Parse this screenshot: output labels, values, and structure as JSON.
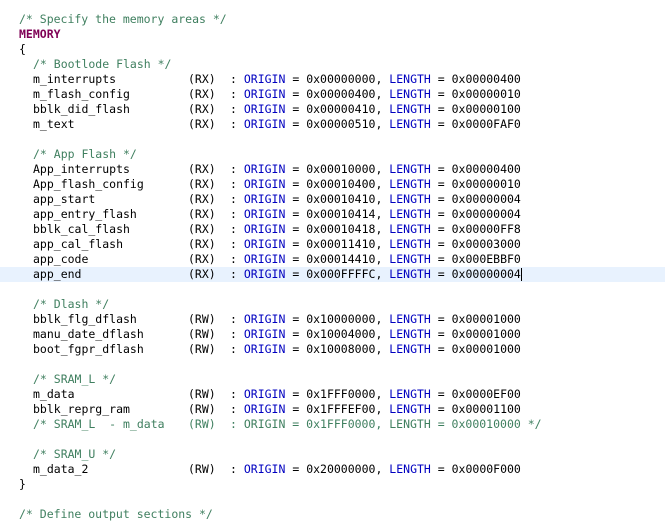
{
  "editor": {
    "header_comment": "/* Specify the memory areas */",
    "keyword_memory": "MEMORY",
    "brace_open": "{",
    "brace_close": "}",
    "footer_comment_partial": "/* Define output sections */",
    "labels": {
      "colon": ":",
      "origin": "ORIGIN",
      "equals": "=",
      "length": "LENGTH",
      "comma": ","
    },
    "groups": [
      {
        "comment": "/* Bootlode Flash */",
        "entries": [
          {
            "name": "m_interrupts",
            "attr": "(RX)",
            "origin": "0x00000000",
            "length": "0x00000400"
          },
          {
            "name": "m_flash_config",
            "attr": "(RX)",
            "origin": "0x00000400",
            "length": "0x00000010"
          },
          {
            "name": "bblk_did_flash",
            "attr": "(RX)",
            "origin": "0x00000410",
            "length": "0x00000100"
          },
          {
            "name": "m_text",
            "attr": "(RX)",
            "origin": "0x00000510",
            "length": "0x0000FAF0"
          }
        ]
      },
      {
        "comment": "/* App Flash */",
        "entries": [
          {
            "name": "App_interrupts",
            "attr": "(RX)",
            "origin": "0x00010000",
            "length": "0x00000400"
          },
          {
            "name": "App_flash_config",
            "attr": "(RX)",
            "origin": "0x00010400",
            "length": "0x00000010"
          },
          {
            "name": "app_start",
            "attr": "(RX)",
            "origin": "0x00010410",
            "length": "0x00000004"
          },
          {
            "name": "app_entry_flash",
            "attr": "(RX)",
            "origin": "0x00010414",
            "length": "0x00000004"
          },
          {
            "name": "bblk_cal_flash",
            "attr": "(RX)",
            "origin": "0x00010418",
            "length": "0x00000FF8"
          },
          {
            "name": "app_cal_flash",
            "attr": "(RX)",
            "origin": "0x00011410",
            "length": "0x00003000"
          },
          {
            "name": "app_code",
            "attr": "(RX)",
            "origin": "0x00014410",
            "length": "0x000EBBF0"
          },
          {
            "name": "app_end",
            "attr": "(RX)",
            "origin": "0x000FFFFC",
            "length": "0x00000004"
          }
        ]
      },
      {
        "comment": "/* Dlash */",
        "entries": [
          {
            "name": "bblk_flg_dflash",
            "attr": "(RW)",
            "origin": "0x10000000",
            "length": "0x00001000"
          },
          {
            "name": "manu_date_dflash",
            "attr": "(RW)",
            "origin": "0x10004000",
            "length": "0x00001000"
          },
          {
            "name": "boot_fgpr_dflash",
            "attr": "(RW)",
            "origin": "0x10008000",
            "length": "0x00001000"
          }
        ]
      },
      {
        "comment": "/* SRAM_L */",
        "entries": [
          {
            "name": "m_data",
            "attr": "(RW)",
            "origin": "0x1FFF0000",
            "length": "0x0000EF00"
          },
          {
            "name": "bblk_reprg_ram",
            "attr": "(RW)",
            "origin": "0x1FFFEF00",
            "length": "0x00001100"
          }
        ],
        "commented_entry": {
          "prefix": "/* SRAM_L  - m_data",
          "attr": "(RW)",
          "text": ": ORIGIN = 0x1FFF0000, LENGTH = 0x00010000 */"
        }
      },
      {
        "comment": "/* SRAM_U */",
        "entries": [
          {
            "name": "m_data_2",
            "attr": "(RW)",
            "origin": "0x20000000",
            "length": "0x0000F000"
          }
        ]
      }
    ]
  }
}
